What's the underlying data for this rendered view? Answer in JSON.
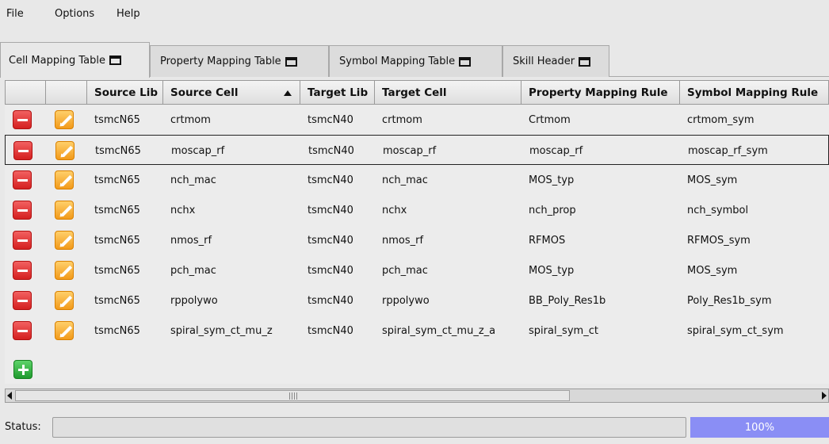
{
  "menu": {
    "file": "File",
    "options": "Options",
    "help": "Help"
  },
  "tabs": [
    {
      "label": "Cell Mapping Table",
      "active": true
    },
    {
      "label": "Property Mapping Table",
      "active": false
    },
    {
      "label": "Symbol Mapping Table",
      "active": false
    },
    {
      "label": "Skill Header",
      "active": false
    }
  ],
  "table": {
    "columns": [
      "",
      "",
      "Source Lib",
      "Source Cell",
      "Target Lib",
      "Target Cell",
      "Property Mapping Rule",
      "Symbol Mapping Rule"
    ],
    "sorted_column": "Source Cell",
    "selected_row": 1,
    "rows": [
      [
        "tsmcN65",
        "crtmom",
        "tsmcN40",
        "crtmom",
        "Crtmom",
        "crtmom_sym"
      ],
      [
        "tsmcN65",
        "moscap_rf",
        "tsmcN40",
        "moscap_rf",
        "moscap_rf",
        "moscap_rf_sym"
      ],
      [
        "tsmcN65",
        "nch_mac",
        "tsmcN40",
        "nch_mac",
        "MOS_typ",
        "MOS_sym"
      ],
      [
        "tsmcN65",
        "nchx",
        "tsmcN40",
        "nchx",
        "nch_prop",
        "nch_symbol"
      ],
      [
        "tsmcN65",
        "nmos_rf",
        "tsmcN40",
        "nmos_rf",
        "RFMOS",
        "RFMOS_sym"
      ],
      [
        "tsmcN65",
        "pch_mac",
        "tsmcN40",
        "pch_mac",
        "MOS_typ",
        "MOS_sym"
      ],
      [
        "tsmcN65",
        "rppolywo",
        "tsmcN40",
        "rppolywo",
        "BB_Poly_Res1b",
        "Poly_Res1b_sym"
      ],
      [
        "tsmcN65",
        "spiral_sym_ct_mu_z",
        "tsmcN40",
        "spiral_sym_ct_mu_z_a",
        "spiral_sym_ct",
        "spiral_sym_ct_sym"
      ]
    ]
  },
  "icons": {
    "delete": "minus-icon",
    "edit": "pencil-icon",
    "add": "plus-icon"
  },
  "colors": {
    "delete": "#e53030",
    "edit": "#f5a623",
    "add": "#2fb53e",
    "progress": "#8a8ef5"
  },
  "status": {
    "label": "Status:",
    "value": "",
    "progress_text": "100%",
    "progress_fraction": 1.0
  }
}
